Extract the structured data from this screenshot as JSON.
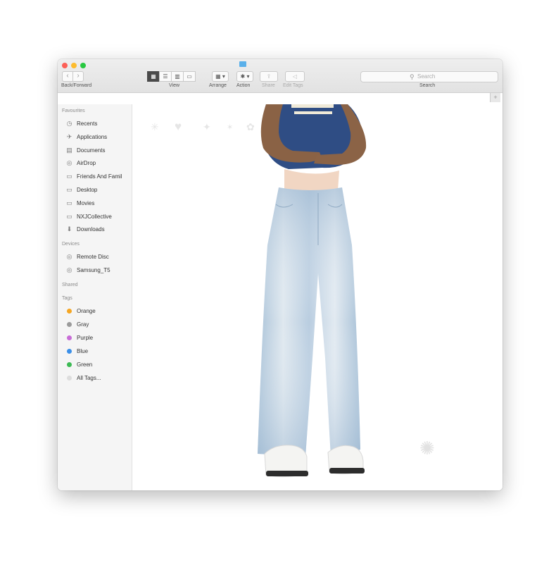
{
  "toolbar": {
    "back_glyph": "‹",
    "forward_glyph": "›",
    "back_forward_label": "Back/Forward",
    "view_label": "View",
    "arrange_label": "Arrange",
    "action_label": "Action",
    "share_label": "Share",
    "edit_tags_label": "Edit Tags",
    "search_label": "Search",
    "search_placeholder": "Search",
    "search_glyph": "⚲",
    "view_glyphs": [
      "▦",
      "☰",
      "▥",
      "▭"
    ],
    "arrange_glyph": "▦ ▾",
    "action_glyph": "✱ ▾",
    "share_glyph": "⇪",
    "tags_glyph": "◁",
    "add_tab_glyph": "+"
  },
  "sidebar": {
    "favourites_header": "Favourites",
    "favourites": [
      {
        "label": "Recents",
        "icon": "clock-icon",
        "glyph": "◷"
      },
      {
        "label": "Applications",
        "icon": "applications-icon",
        "glyph": "✈"
      },
      {
        "label": "Documents",
        "icon": "documents-icon",
        "glyph": "▤"
      },
      {
        "label": "AirDrop",
        "icon": "airdrop-icon",
        "glyph": "◎"
      },
      {
        "label": "Friends And Famil",
        "icon": "folder-icon",
        "glyph": "▭"
      },
      {
        "label": "Desktop",
        "icon": "desktop-icon",
        "glyph": "▭"
      },
      {
        "label": "Movies",
        "icon": "movies-icon",
        "glyph": "▭"
      },
      {
        "label": "NXJCollective",
        "icon": "folder-icon",
        "glyph": "▭"
      },
      {
        "label": "Downloads",
        "icon": "downloads-icon",
        "glyph": "⬇"
      }
    ],
    "devices_header": "Devices",
    "devices": [
      {
        "label": "Remote Disc",
        "icon": "disc-icon",
        "glyph": "◎"
      },
      {
        "label": "Samsung_T5",
        "icon": "drive-icon",
        "glyph": "◎"
      }
    ],
    "shared_header": "Shared",
    "tags_header": "Tags",
    "tags": [
      {
        "label": "Orange",
        "color": "#f5a623"
      },
      {
        "label": "Gray",
        "color": "#9b9b9b"
      },
      {
        "label": "Purple",
        "color": "#c86dd7"
      },
      {
        "label": "Blue",
        "color": "#3b8fe8"
      },
      {
        "label": "Green",
        "color": "#3cba54"
      },
      {
        "label": "All Tags...",
        "color": "#dddddd"
      }
    ]
  },
  "content": {
    "background": "#ffffff",
    "decorations": [
      "✳",
      "♥",
      "✦",
      "✶",
      "✿"
    ],
    "sparkle_glyph": "✺"
  }
}
